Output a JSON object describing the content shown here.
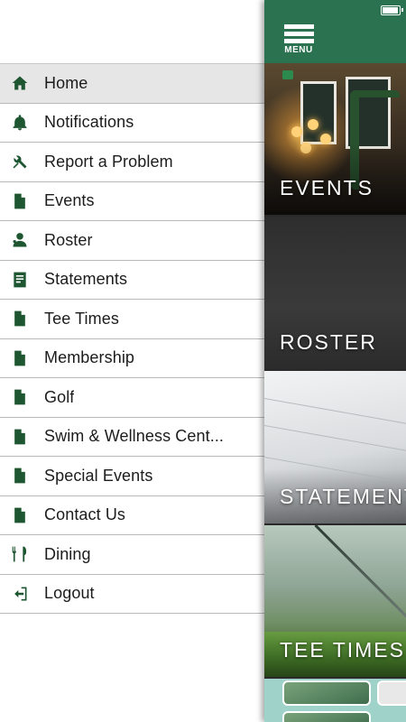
{
  "drawer": {
    "items": [
      {
        "label": "Home",
        "icon": "home-icon",
        "active": true
      },
      {
        "label": "Notifications",
        "icon": "bell-icon",
        "active": false
      },
      {
        "label": "Report a Problem",
        "icon": "tools-icon",
        "active": false
      },
      {
        "label": "Events",
        "icon": "document-icon",
        "active": false
      },
      {
        "label": "Roster",
        "icon": "person-icon",
        "active": false
      },
      {
        "label": "Statements",
        "icon": "statement-icon",
        "active": false
      },
      {
        "label": "Tee Times",
        "icon": "document-icon",
        "active": false
      },
      {
        "label": "Membership",
        "icon": "document-icon",
        "active": false
      },
      {
        "label": "Golf",
        "icon": "document-icon",
        "active": false
      },
      {
        "label": "Swim & Wellness Cent...",
        "icon": "document-icon",
        "active": false
      },
      {
        "label": "Special Events",
        "icon": "document-icon",
        "active": false
      },
      {
        "label": "Contact Us",
        "icon": "document-icon",
        "active": false
      },
      {
        "label": "Dining",
        "icon": "fork-knife-icon",
        "active": false
      },
      {
        "label": "Logout",
        "icon": "logout-icon",
        "active": false
      }
    ]
  },
  "topbar": {
    "menu_label": "MENU",
    "accent_color": "#2b7350"
  },
  "tiles": {
    "events": "EVENTS",
    "roster": "ROSTER",
    "statements": "STATEMENTS",
    "tee_times": "TEE TIMES"
  },
  "colors": {
    "icon_green": "#1e5631",
    "active_row": "#e6e6e6"
  }
}
